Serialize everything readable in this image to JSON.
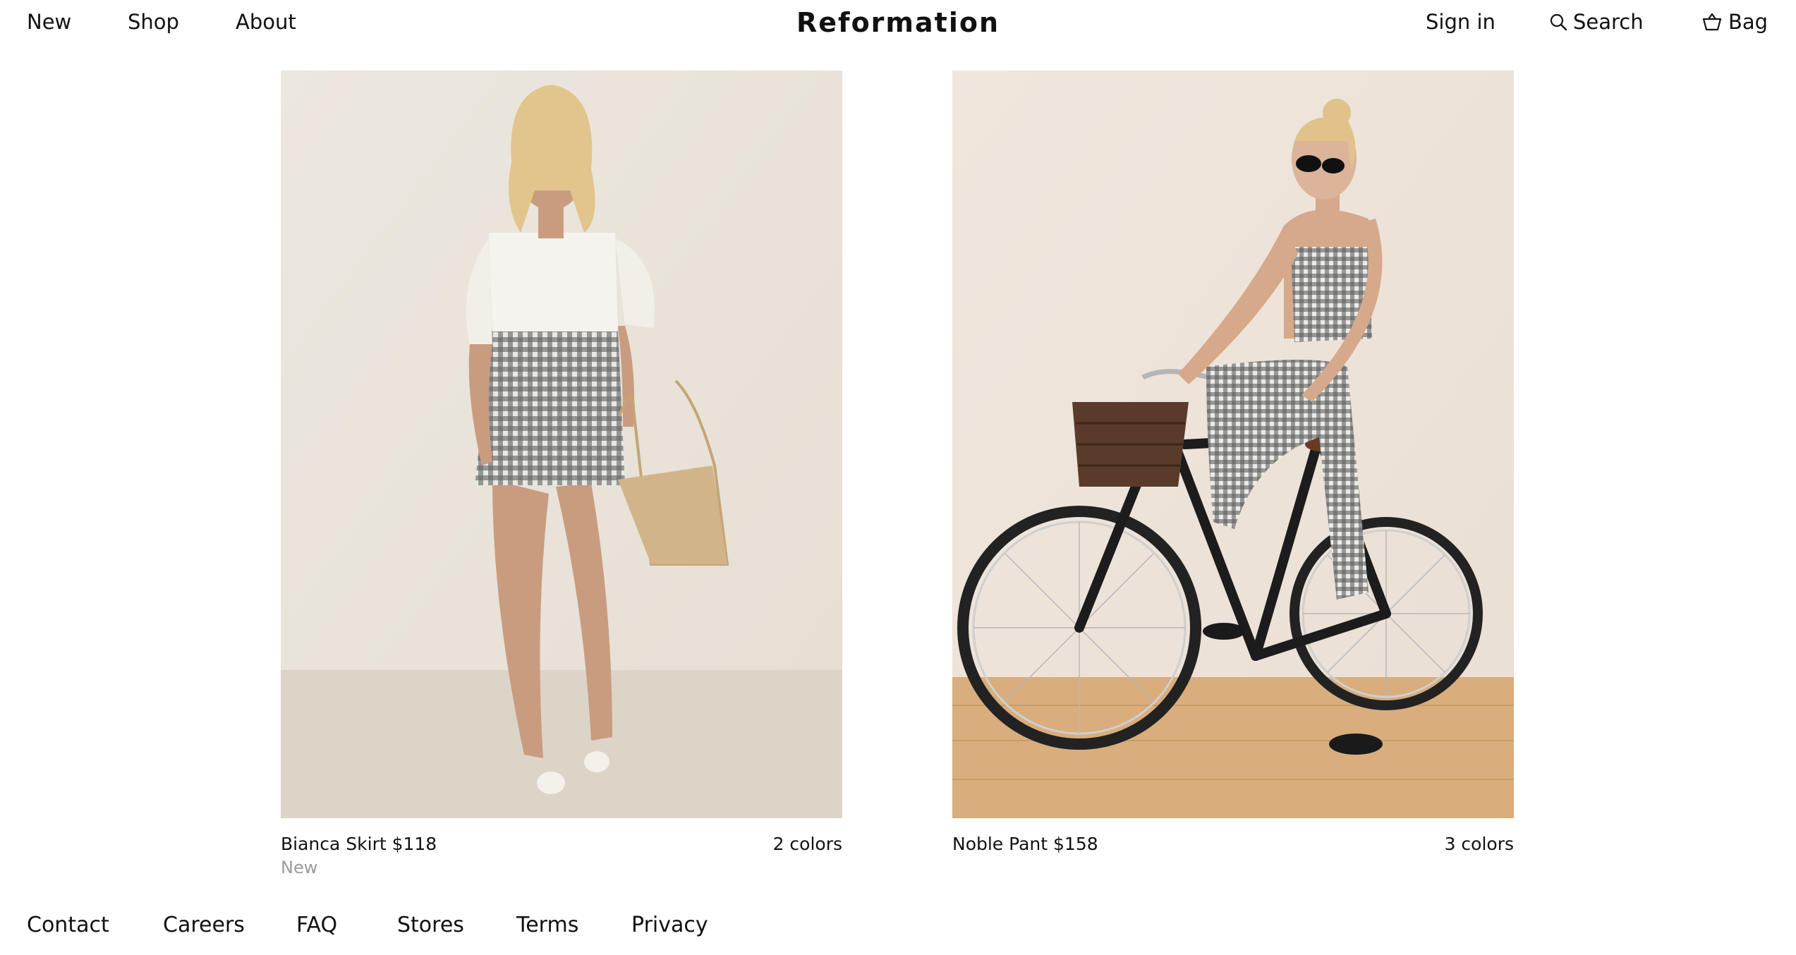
{
  "header": {
    "nav_left": {
      "new": "New",
      "shop": "Shop",
      "about": "About"
    },
    "brand": "Reformation",
    "nav_right": {
      "sign_in": "Sign in",
      "search": "Search",
      "bag": "Bag"
    },
    "icons": {
      "search": "search-icon",
      "bag": "bag-icon"
    }
  },
  "products": [
    {
      "name_price": "Bianca Skirt $118",
      "colors": "2 colors",
      "tag": "New"
    },
    {
      "name_price": "Noble Pant $158",
      "colors": "3 colors"
    }
  ],
  "footer": {
    "links": {
      "contact": "Contact",
      "careers": "Careers",
      "faq": "FAQ",
      "stores": "Stores",
      "terms": "Terms",
      "privacy": "Privacy"
    }
  },
  "colors": {
    "text": "#111111",
    "muted": "#9a9a9a",
    "background": "#ffffff"
  }
}
